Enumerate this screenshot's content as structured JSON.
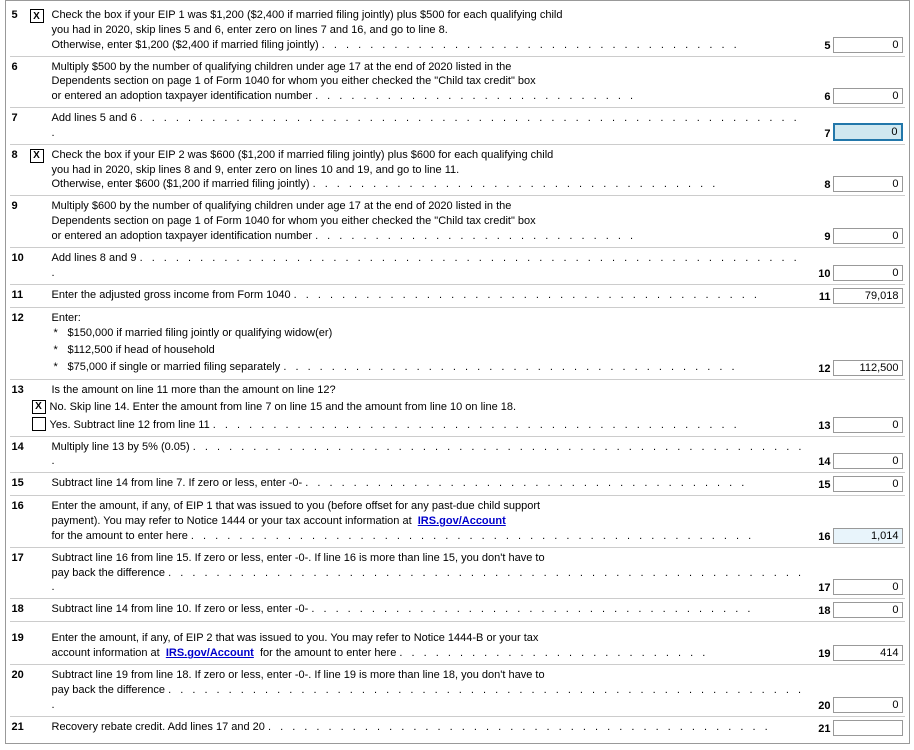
{
  "form": {
    "lines": [
      {
        "id": "line5",
        "num": "5",
        "has_checkbox": true,
        "checkbox_checked": true,
        "text_parts": [
          "Check the box if your EIP 1 was $1,200 ($2,400 if married filing jointly) plus $500 for each qualifying child",
          "you had in 2020, skip lines 5 and 6, enter zero on lines 7 and 16, and go to line 8.",
          "Otherwise, enter $1,200 ($2,400 if married filing jointly)"
        ],
        "line_ref": "5",
        "amount": "0",
        "amount_class": ""
      },
      {
        "id": "line6",
        "num": "6",
        "has_checkbox": false,
        "text_parts": [
          "Multiply $500 by the number of qualifying children under age 17 at the end of 2020 listed in the",
          "Dependents section on page 1 of Form 1040 for whom you either checked the \"Child tax credit\" box",
          "or entered an adoption taxpayer identification number"
        ],
        "line_ref": "6",
        "amount": "0",
        "amount_class": ""
      },
      {
        "id": "line7",
        "num": "7",
        "has_checkbox": false,
        "text_parts": [
          "Add lines 5 and 6"
        ],
        "line_ref": "7",
        "amount": "0",
        "amount_class": "highlighted"
      },
      {
        "id": "line8",
        "num": "8",
        "has_checkbox": true,
        "checkbox_checked": true,
        "text_parts": [
          "Check the box if your EIP 2 was $600 ($1,200 if married filing jointly) plus $600 for each qualifying child",
          "you had in 2020, skip lines 8 and 9, enter zero on lines 10 and 19, and go to line 11.",
          "Otherwise, enter $600 ($1,200 if married filing jointly)"
        ],
        "line_ref": "8",
        "amount": "0",
        "amount_class": ""
      },
      {
        "id": "line9",
        "num": "9",
        "has_checkbox": false,
        "text_parts": [
          "Multiply $600 by the number of qualifying children under age 17 at the end of 2020 listed in the",
          "Dependents section on page 1 of Form 1040 for whom you either checked the \"Child tax credit\" box",
          "or entered an adoption taxpayer identification number"
        ],
        "line_ref": "9",
        "amount": "0",
        "amount_class": ""
      },
      {
        "id": "line10",
        "num": "10",
        "has_checkbox": false,
        "text_parts": [
          "Add lines 8 and 9"
        ],
        "line_ref": "10",
        "amount": "0",
        "amount_class": ""
      },
      {
        "id": "line11",
        "num": "11",
        "has_checkbox": false,
        "text_parts": [
          "Enter the adjusted gross income from Form 1040"
        ],
        "line_ref": "11",
        "amount": "79,018",
        "amount_class": ""
      },
      {
        "id": "line12",
        "num": "12",
        "has_checkbox": false,
        "is_enter": true,
        "enter_label": "Enter:",
        "bullets": [
          "$150,000 if married filing jointly or qualifying widow(er)",
          "$112,500 if head of household",
          "$75,000 if single or married filing separately"
        ],
        "line_ref": "12",
        "amount": "112,500",
        "amount_class": ""
      },
      {
        "id": "line13",
        "num": "13",
        "has_checkbox": false,
        "is_question": true,
        "question": "Is the amount on line 11 more than the amount on line 12?",
        "options": [
          {
            "checked": true,
            "label": "No. Skip line 14. Enter the amount from line 7 on line 15 and the amount from line 10 on line 18."
          },
          {
            "checked": false,
            "label": "Yes. Subtract line 12 from line 11"
          }
        ],
        "line_ref": "13",
        "amount": "0",
        "amount_class": ""
      },
      {
        "id": "line14",
        "num": "14",
        "has_checkbox": false,
        "text_parts": [
          "Multiply line 13 by 5% (0.05)"
        ],
        "line_ref": "14",
        "amount": "0",
        "amount_class": ""
      },
      {
        "id": "line15",
        "num": "15",
        "has_checkbox": false,
        "text_parts": [
          "Subtract line 14 from line 7. If zero or less, enter -0-"
        ],
        "line_ref": "15",
        "amount": "0",
        "amount_class": ""
      },
      {
        "id": "line16",
        "num": "16",
        "has_checkbox": false,
        "text_parts": [
          "Enter the amount, if any, of EIP 1 that was issued to you (before offset for any past-due child support",
          "payment). You may refer to Notice 1444 or your tax account information at",
          "IRS.gov/Account",
          "for the amount to enter here"
        ],
        "has_link": true,
        "link_text": "IRS.gov/Account",
        "line_ref": "16",
        "amount": "1,014",
        "amount_class": "shaded"
      },
      {
        "id": "line17",
        "num": "17",
        "has_checkbox": false,
        "text_parts": [
          "Subtract line 16 from line 15. If zero or less, enter -0-. If line 16 is more than line 15, you don't have to",
          "pay back the difference"
        ],
        "line_ref": "17",
        "amount": "0",
        "amount_class": ""
      },
      {
        "id": "line18",
        "num": "18",
        "has_checkbox": false,
        "text_parts": [
          "Subtract line 14 from line 10. If zero or less, enter -0-"
        ],
        "line_ref": "18",
        "amount": "0",
        "amount_class": ""
      },
      {
        "id": "line19",
        "num": "19",
        "has_checkbox": false,
        "text_parts": [
          "Enter the amount, if any, of EIP 2 that was issued to you. You may refer to Notice 1444-B or your tax",
          "account information at",
          "IRS.gov/Account",
          "for the amount to enter here"
        ],
        "has_link": true,
        "link_text": "IRS.gov/Account",
        "line_ref": "19",
        "amount": "414",
        "amount_class": ""
      },
      {
        "id": "line20",
        "num": "20",
        "has_checkbox": false,
        "text_parts": [
          "Subtract line 19 from line 18. If zero or less, enter -0-. If line 19 is more than line 18, you don't have to",
          "pay back the difference"
        ],
        "line_ref": "20",
        "amount": "0",
        "amount_class": ""
      },
      {
        "id": "line21",
        "num": "21",
        "has_checkbox": false,
        "text_parts": [
          "Recovery rebate credit. Add lines 17 and 20"
        ],
        "line_ref": "21",
        "amount": "",
        "amount_class": ""
      }
    ]
  }
}
